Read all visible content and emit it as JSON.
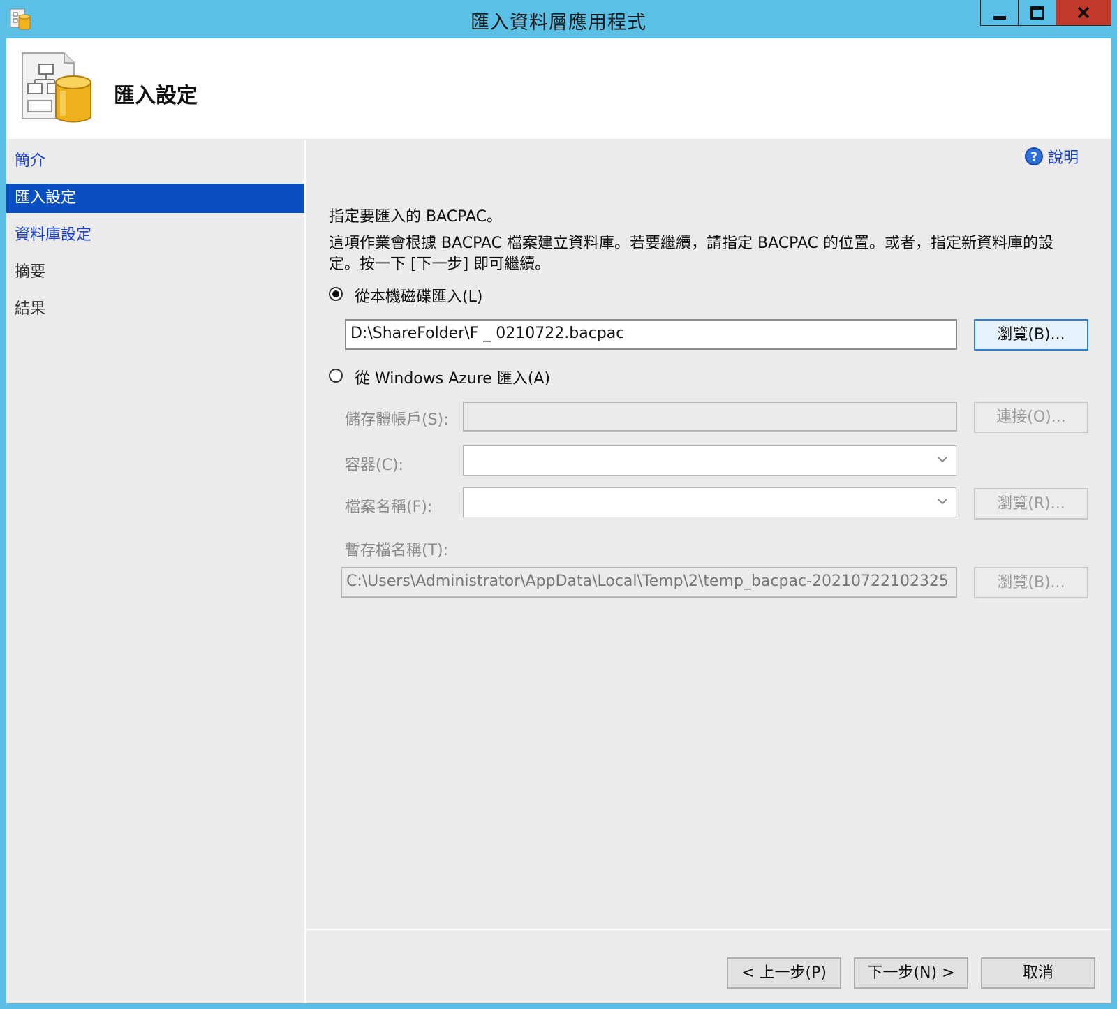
{
  "window": {
    "title": "匯入資料層應用程式",
    "controls": {
      "minimize_icon": "minimize-icon",
      "maximize_icon": "maximize-icon",
      "close_icon": "close-icon"
    }
  },
  "header": {
    "title": "匯入設定",
    "icon": "dac-database-icon"
  },
  "sidebar": {
    "items": [
      {
        "label": "簡介",
        "state": "link"
      },
      {
        "label": "匯入設定",
        "state": "selected"
      },
      {
        "label": "資料庫設定",
        "state": "link"
      },
      {
        "label": "摘要",
        "state": "plain"
      },
      {
        "label": "結果",
        "state": "plain"
      }
    ]
  },
  "help": {
    "label": "說明"
  },
  "main": {
    "heading": "指定要匯入的 BACPAC。",
    "description_line1": "這項作業會根據 BACPAC 檔案建立資料庫。若要繼續，請指定 BACPAC 的位置。或者，指定新資料庫的設",
    "description_line2": "定。按一下 [下一步] 即可繼續。",
    "local": {
      "radio_label": "從本機磁碟匯入(L)",
      "selected": true,
      "path_value": "D:\\ShareFolder\\F          _ 0210722.bacpac",
      "browse_label": "瀏覽(B)..."
    },
    "azure": {
      "radio_label": "從 Windows Azure 匯入(A)",
      "selected": false,
      "storage_label": "儲存體帳戶(S):",
      "storage_value": "",
      "connect_label": "連接(O)...",
      "container_label": "容器(C):",
      "container_value": "",
      "filename_label": "檔案名稱(F):",
      "filename_value": "",
      "filename_browse_label": "瀏覽(R)...",
      "temp_label": "暫存檔名稱(T):",
      "temp_value": "C:\\Users\\Administrator\\AppData\\Local\\Temp\\2\\temp_bacpac-20210722102325",
      "temp_browse_label": "瀏覽(B)..."
    }
  },
  "footer": {
    "back_label": "< 上一步(P)",
    "next_label": "下一步(N) >",
    "cancel_label": "取消"
  },
  "colors": {
    "titlebar": "#5bc0e6",
    "close": "#c0392b",
    "selected": "#0a4fc2",
    "link": "#1a3fcc"
  }
}
